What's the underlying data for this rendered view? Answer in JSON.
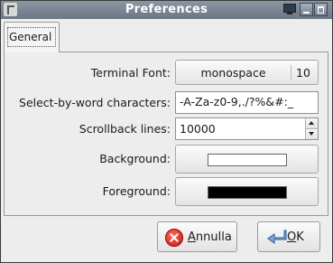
{
  "window": {
    "title": "Preferences"
  },
  "tabs": [
    {
      "label": "General",
      "selected": true
    }
  ],
  "form": {
    "terminal_font": {
      "label": "Terminal Font:",
      "family": "monospace",
      "size": "10"
    },
    "word_chars": {
      "label": "Select-by-word characters:",
      "value": "-A-Za-z0-9,./?%&#:_"
    },
    "scrollback": {
      "label": "Scrollback lines:",
      "value": "10000"
    },
    "background": {
      "label": "Background:",
      "color": "#ffffff"
    },
    "foreground": {
      "label": "Foreground:",
      "color": "#000000"
    }
  },
  "buttons": {
    "cancel": {
      "mnemonic": "A",
      "rest": "nnulla",
      "icon": "cancel-icon"
    },
    "ok": {
      "mnemonic": "O",
      "rest": "K",
      "icon": "enter-arrow-icon"
    }
  }
}
